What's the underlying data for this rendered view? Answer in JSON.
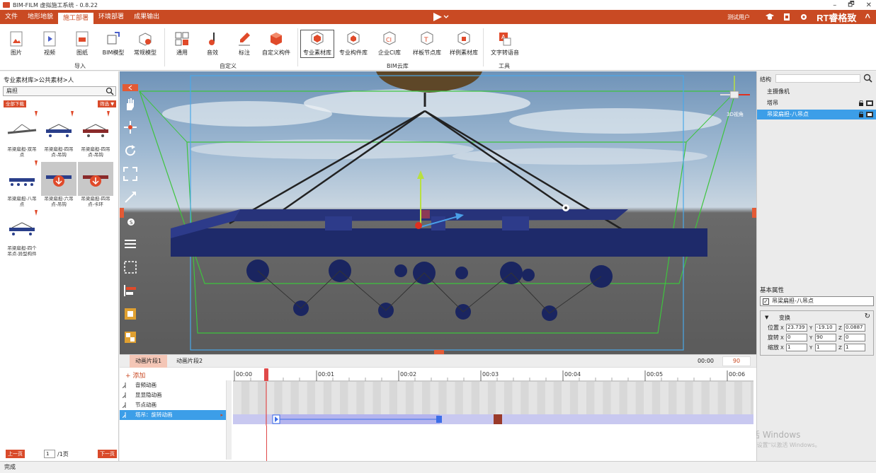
{
  "window": {
    "title": "BIM-FILM 虚拟施工系统 - 0.8.22",
    "min": "–",
    "max": "🗗",
    "close": "✕"
  },
  "menu": {
    "items": [
      "文件",
      "地形地貌",
      "施工部署",
      "环境部署",
      "成果输出"
    ],
    "active_index": 2,
    "user": "测试用户",
    "brand": "RT睿格致",
    "brand_caret": "^"
  },
  "ribbon": {
    "tools": [
      {
        "label": "图片"
      },
      {
        "label": "视频"
      },
      {
        "label": "图纸"
      },
      {
        "label": "BIM模型"
      },
      {
        "label": "常规模型"
      },
      {
        "label": "通用"
      },
      {
        "label": "音效"
      },
      {
        "label": "标注"
      },
      {
        "label": "自定义构件"
      },
      {
        "label": "专业素材库"
      },
      {
        "label": "专业构件库"
      },
      {
        "label": "企业CI库"
      },
      {
        "label": "样板节点库"
      },
      {
        "label": "样例素材库"
      },
      {
        "label": "文字转语音"
      }
    ],
    "groups": [
      "导入",
      "自定义",
      "BIM云库",
      "工具"
    ]
  },
  "left_panel": {
    "breadcrumb": "专业素材库>公共素材>人",
    "search_value": "扁担",
    "download_all": "全部下载",
    "filter": "筛选 ▼",
    "items": [
      {
        "caption_1": "吊梁扁担-双吊",
        "caption_2": "点"
      },
      {
        "caption_1": "吊梁扁担-四吊",
        "caption_2": "点-吊钩"
      },
      {
        "caption_1": "吊梁扁担-四吊",
        "caption_2": "点-吊钩"
      },
      {
        "caption_1": "吊梁扁担-八吊",
        "caption_2": "点"
      },
      {
        "caption_1": "吊梁扁担-六吊",
        "caption_2": "点-吊钩"
      },
      {
        "caption_1": "吊梁扁担-四吊",
        "caption_2": "点-卡环"
      },
      {
        "caption_1": "吊梁扁担-四个",
        "caption_2": "吊点-异型构件"
      }
    ],
    "pager": {
      "prev": "上一页",
      "page": "1",
      "total": "/1页",
      "next": "下一页"
    }
  },
  "viewport": {
    "view_label": "3D视角"
  },
  "right_panel": {
    "structure_title": "结构",
    "tree": [
      {
        "label": "主摄像机"
      },
      {
        "label": "塔吊"
      },
      {
        "label": "吊梁扁担-八吊点"
      }
    ],
    "basic_props": "基本属性",
    "object_name": "吊梁扁担-八吊点",
    "transform_title": "变换",
    "transform": {
      "position_label": "位置",
      "position": {
        "x": "23.739",
        "y": "-19.10",
        "z": "0.0887"
      },
      "rotation_label": "旋转",
      "rotation": {
        "x": "0",
        "y": "90",
        "z": "0"
      },
      "scale_label": "缩放",
      "scale": {
        "x": "1",
        "y": "1",
        "z": "1"
      }
    },
    "watermark": "激活 Windows",
    "watermark_sub": "转到\"设置\"以激活 Windows。"
  },
  "timeline": {
    "tabs": [
      "动画片段1",
      "动画片段2"
    ],
    "time": "00:00",
    "fps": "90",
    "add": "+ 添加",
    "tracks": [
      "音频动画",
      "显显隐动画",
      "节点动画",
      "塔吊：旋转动画"
    ],
    "ruler": [
      "00:00",
      "00:01",
      "00:02",
      "00:03",
      "00:04",
      "00:05",
      "00:06"
    ]
  },
  "status": {
    "text": "完成"
  },
  "colors": {
    "accent": "#c94a23",
    "select": "#3c9ee8"
  }
}
